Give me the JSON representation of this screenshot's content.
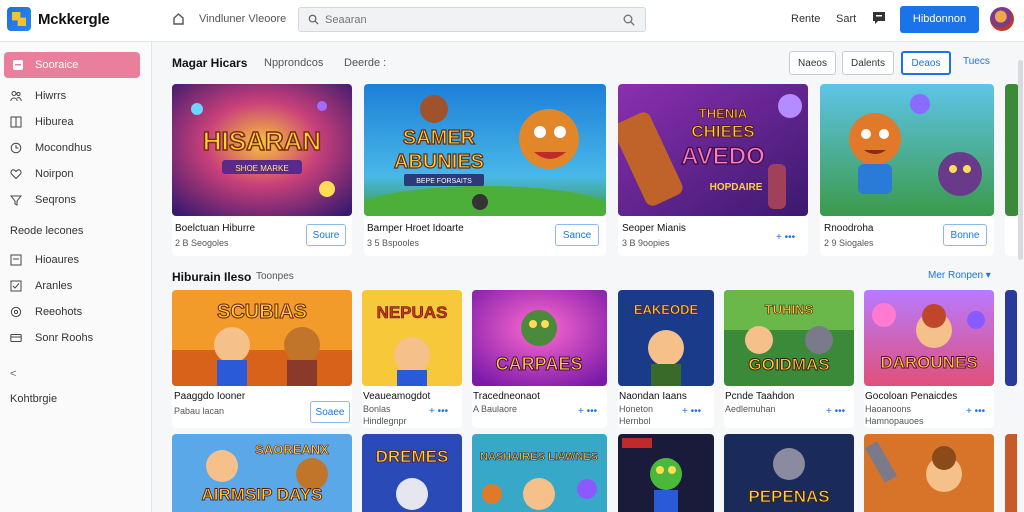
{
  "header": {
    "brand": "Mckkergle",
    "home_label": "Vindluner Vleoore",
    "search_placeholder": "Seaaran",
    "link1": "Rente",
    "link2": "Sart",
    "signin_label": "Hibdonnon"
  },
  "sidebar": {
    "active_label": "Sooraice",
    "items_top": [
      {
        "label": "Hiwrrs",
        "icon": "people-icon"
      },
      {
        "label": "Hiburea",
        "icon": "book-icon"
      },
      {
        "label": "Mocondhus",
        "icon": "clock-icon"
      },
      {
        "label": "Noirpon",
        "icon": "heart-icon"
      },
      {
        "label": "Seqrons",
        "icon": "filter-icon"
      }
    ],
    "section1": "Reode lecones",
    "items_mid": [
      {
        "label": "Hioaures",
        "icon": "square-icon"
      },
      {
        "label": "Aranles",
        "icon": "check-icon"
      },
      {
        "label": "Reeohots",
        "icon": "gear-icon"
      },
      {
        "label": "Sonr Roohs",
        "icon": "card-icon"
      }
    ],
    "arrow": "<",
    "section2": "Kohtbrgie"
  },
  "featured": {
    "title": "Magar Hicars",
    "sub1": "Npprondcos",
    "sub2": "Deerde :",
    "filters": [
      "Naeos",
      "Dalents",
      "Deaos"
    ],
    "filter_link": "Tuecs",
    "cards": [
      {
        "art": "HISARAN",
        "art_sub": "SHOE MARKE",
        "title": "Boelctuan Hiburre",
        "meta": "2 B Seogoles",
        "button": "Soure"
      },
      {
        "art": "SAMER ABUNIES",
        "art_sub": "BEPE FORSAITS",
        "title": "Barnper Hroet Idoarte",
        "meta": "3 5 Bspooles",
        "button": "Sance"
      },
      {
        "art": "CHIEES AVEDO",
        "art_sub": "HOPDAIRE",
        "title": "Seoper Mianis",
        "meta": "3 B 9oopies",
        "button": "+ •••"
      },
      {
        "art": "",
        "art_sub": "",
        "title": "Rnoodroha",
        "meta": "2 9 Siogales",
        "button": "Bonne"
      }
    ]
  },
  "popular": {
    "title": "Hiburain",
    "title2": "Ileso",
    "sub": "Toonpes",
    "more_link": "Mer Ronpen ▾",
    "cards": [
      {
        "art": "SCUBIAS",
        "title": "Paaggdo Iooner",
        "meta": "Pabau lacan",
        "meta2": "",
        "button": "Soaee"
      },
      {
        "art": "NEPUAS",
        "title": "Veaueamogdot",
        "meta": "Bonlas",
        "meta2": "Hindlegnpr",
        "button": "+ •••"
      },
      {
        "art": "CARPAES",
        "title": "Tracedneonaot",
        "meta": "A Baulaore",
        "meta2": "",
        "button": "+ •••"
      },
      {
        "art": "EAKEODE",
        "title": "Naondan Iaans",
        "meta": "Honeton",
        "meta2": "Hernbol",
        "button": "+ •••"
      },
      {
        "art": "GOIDMAS",
        "title": "Pcnde Taahdon",
        "meta": "Aedlemuhan",
        "meta2": "",
        "button": "+ •••"
      },
      {
        "art": "DAROUNES",
        "title": "Gocoloan Penaicdes",
        "meta": "Haoanoons",
        "meta2": "Hamnopauoes",
        "button": "+ •••"
      }
    ]
  },
  "row3": [
    {
      "art": "AIRMSIP DAYS",
      "art_top": "SAOREANX"
    },
    {
      "art": "DREMES",
      "art_top": ""
    },
    {
      "art": "NASHAIRES LIAWNES",
      "art_top": ""
    },
    {
      "art": "",
      "art_top": ""
    },
    {
      "art": "PEPENAS",
      "art_top": ""
    },
    {
      "art": "",
      "art_top": ""
    }
  ],
  "colors": {
    "accent": "#1a73e8",
    "sidebar_active": "#e97f9c"
  }
}
